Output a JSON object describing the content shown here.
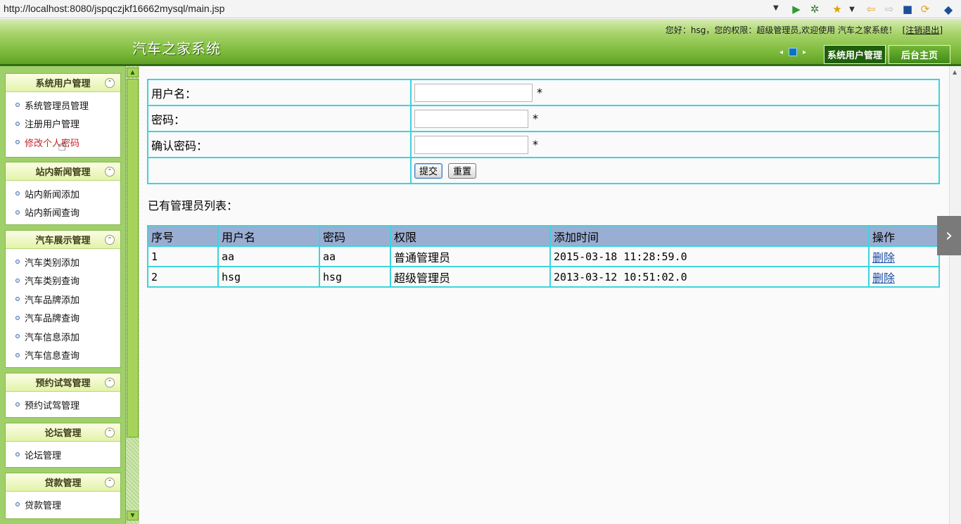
{
  "browser": {
    "url": "http://localhost:8080/jspqczjkf16662mysql/main.jsp"
  },
  "header": {
    "site_title": "汽车之家系统",
    "greeting": "您好：hsg，您的权限：超级管理员,欢迎使用 汽车之家系统！",
    "logout_label": "注销退出",
    "tabs": [
      {
        "label": "系统用户管理"
      },
      {
        "label": "后台主页"
      }
    ]
  },
  "sidebar": {
    "panels": [
      {
        "title": "系统用户管理",
        "items": [
          "系统管理员管理",
          "注册用户管理",
          "修改个人密码"
        ]
      },
      {
        "title": "站内新闻管理",
        "items": [
          "站内新闻添加",
          "站内新闻查询"
        ]
      },
      {
        "title": "汽车展示管理",
        "items": [
          "汽车类别添加",
          "汽车类别查询",
          "汽车品牌添加",
          "汽车品牌查询",
          "汽车信息添加",
          "汽车信息查询"
        ]
      },
      {
        "title": "预约试驾管理",
        "items": [
          "预约试驾管理"
        ]
      },
      {
        "title": "论坛管理",
        "items": [
          "论坛管理"
        ]
      },
      {
        "title": "贷款管理",
        "items": [
          "贷款管理"
        ]
      }
    ]
  },
  "form": {
    "username_label": "用户名：",
    "password_label": "密码：",
    "confirm_label": "确认密码：",
    "required_mark": "*",
    "submit_label": "提交",
    "reset_label": "重置"
  },
  "admin_list": {
    "title": "已有管理员列表：",
    "columns": [
      "序号",
      "用户名",
      "密码",
      "权限",
      "添加时间",
      "操作"
    ],
    "rows": [
      {
        "no": "1",
        "username": "aa",
        "password": "aa",
        "role": "普通管理员",
        "added": "2015-03-18 11:28:59.0",
        "action": "删除"
      },
      {
        "no": "2",
        "username": "hsg",
        "password": "hsg",
        "role": "超级管理员",
        "added": "2013-03-12 10:51:02.0",
        "action": "删除"
      }
    ]
  }
}
